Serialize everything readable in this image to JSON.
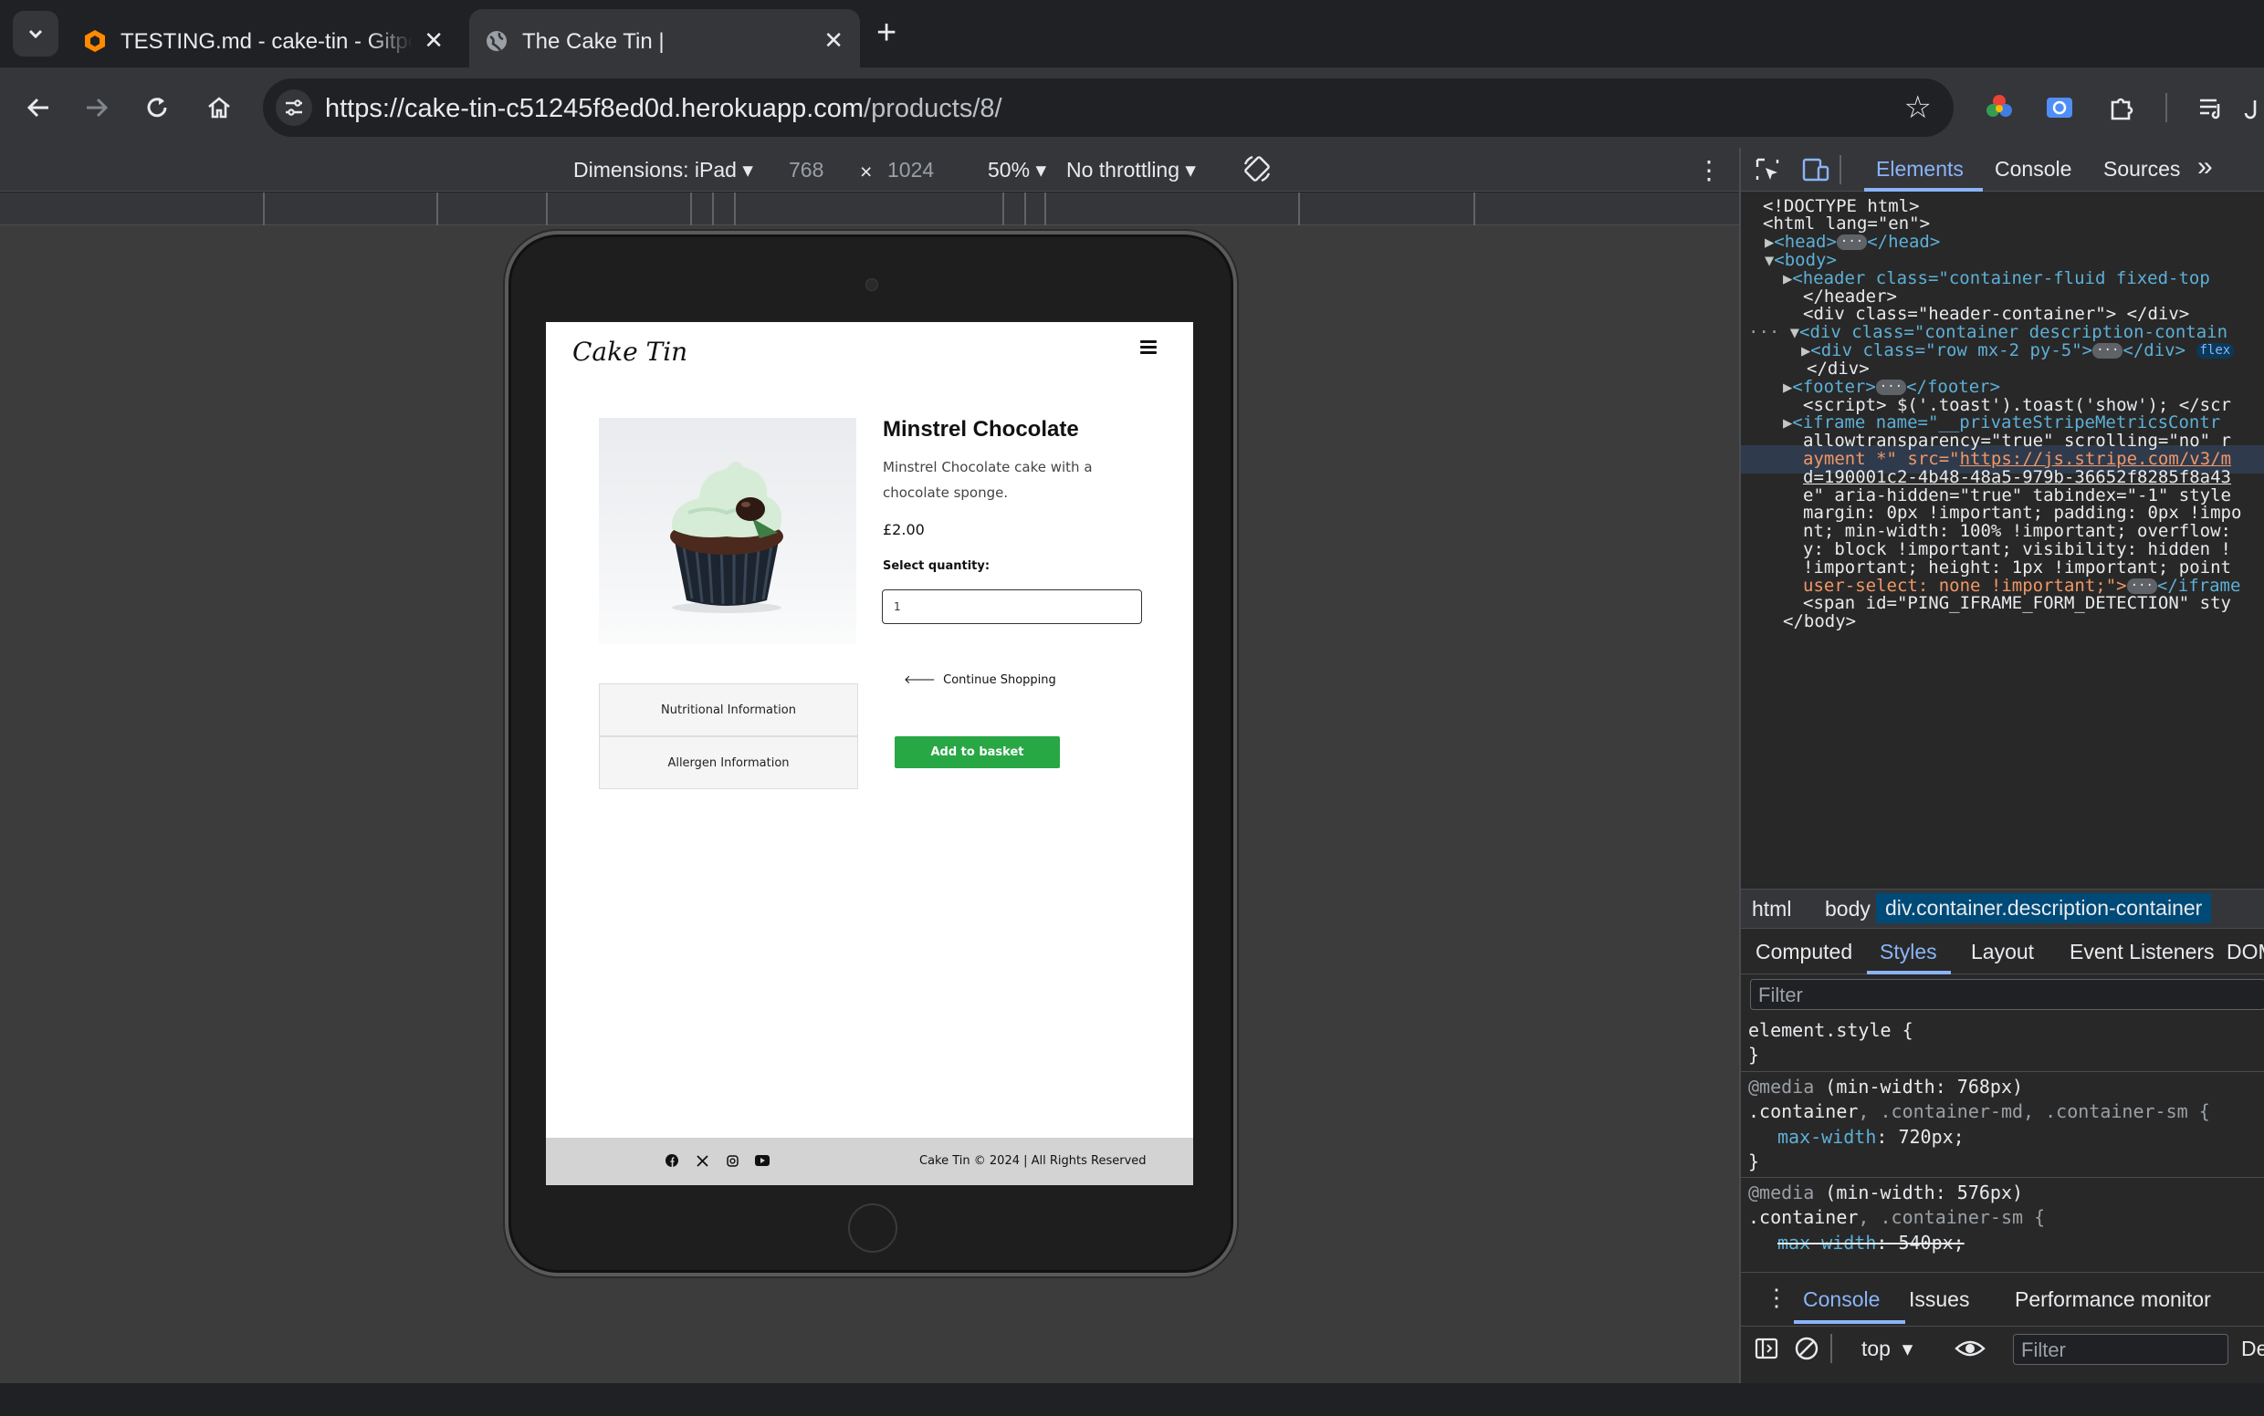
{
  "browser": {
    "tabs": [
      {
        "title": "TESTING.md - cake-tin - Gitpod",
        "active": false,
        "icon": "gitpod-icon"
      },
      {
        "title": "The Cake Tin |",
        "active": true,
        "icon": "globe-icon"
      }
    ],
    "new_tab_label": "+",
    "close_label": "✕",
    "url_host": "https://cake-tin-c51245f8ed0d.herokuapp.com",
    "url_path": "/products/8/"
  },
  "device_toolbar": {
    "dimensions_label": "Dimensions: iPad",
    "width": "768",
    "times": "×",
    "height": "1024",
    "zoom": "50%",
    "throttling": "No throttling"
  },
  "page": {
    "logo": "Cake Tin",
    "product_name": "Minstrel Chocolate",
    "product_description": "Minstrel Chocolate cake with a chocolate sponge.",
    "price": "£2.00",
    "quantity_label": "Select quantity:",
    "quantity_value": "1",
    "continue_shopping": "Continue Shopping",
    "nutritional_info": "Nutritional Information",
    "allergen_info": "Allergen Information",
    "add_to_basket": "Add to basket",
    "footer_copy": "Cake Tin © 2024 | All Rights Reserved",
    "social_icons": [
      "facebook-icon",
      "x-icon",
      "instagram-icon",
      "youtube-icon"
    ]
  },
  "devtools": {
    "tabs": [
      "Elements",
      "Console",
      "Sources"
    ],
    "active_tab": "Elements",
    "more_tabs": "»",
    "dom_lines": [
      "<!DOCTYPE html>",
      "<html lang=\"en\">",
      "<head>",
      "</head>",
      "<body>",
      "<header class=\"container-fluid fixed-top",
      "</header>",
      "<div class=\"header-container\"> </div>",
      "<div class=\"container description-contain",
      "<div class=\"row mx-2 py-5\">",
      "</div>",
      "<footer>",
      "</footer>",
      "<script> $('.toast').toast('show'); </scr",
      "<iframe name=\"__privateStripeMetricsContr",
      "allowtransparency=\"true\" scrolling=\"no\" r",
      "ayment *\" src=\"",
      "https://js.stripe.com/v3/m",
      "d=190001c2-4b48-48a5-979b-36652f8285f8a43",
      "e\" aria-hidden=\"true\" tabindex=\"-1\" style",
      "margin: 0px !important; padding: 0px !impo",
      "nt; min-width: 100% !important; overflow:",
      "y: block !important; visibility: hidden !",
      "!important; height: 1px !important; point",
      "user-select: none !important;\">",
      "</iframe",
      "<span id=\"PING_IFRAME_FORM_DETECTION\" sty",
      "</body>",
      "flex"
    ],
    "breadcrumbs": [
      "html",
      "body",
      "div.container.description-container"
    ],
    "subtabs": [
      "Computed",
      "Styles",
      "Layout",
      "Event Listeners",
      "DOM"
    ],
    "active_subtab": "Styles",
    "filter_placeholder": "Filter",
    "styles": {
      "element_style": "element.style {",
      "close_brace": "}",
      "media1": "@media",
      "media1_cond": "(min-width: 768px)",
      "rule1_selector": ".container",
      "rule1_rest": ", .container-md, .container-sm {",
      "rule1_prop": "max-width",
      "rule1_val": "720px;",
      "media2": "@media",
      "media2_cond": "(min-width: 576px)",
      "rule2_selector": ".container",
      "rule2_rest": ", .container-sm {",
      "rule2_prop": "max-width",
      "rule2_val": "540px;"
    },
    "drawer_tabs": [
      "Console",
      "Issues",
      "Performance monitor"
    ],
    "active_drawer_tab": "Console",
    "context": "top",
    "console_filter": "Filter",
    "default_levels": "De"
  },
  "colors": {
    "accent": "#8ab4f8",
    "basket_button": "#28a745",
    "footer_bg": "#d3d3d3"
  }
}
